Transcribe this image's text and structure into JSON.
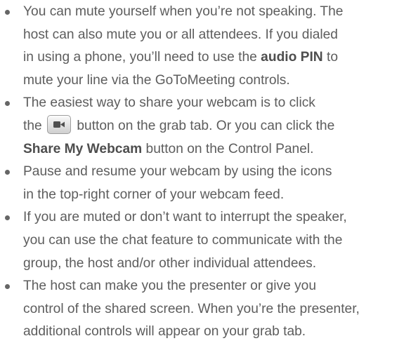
{
  "items": [
    {
      "lines": [
        {
          "text": "You can mute yourself when you’re not speaking. The"
        },
        {
          "text": "host can also mute you or all attendees. If you dialed"
        },
        {
          "before": "in using a phone, you’ll need to use the ",
          "strong": "audio PIN",
          "after": " to"
        },
        {
          "text": "mute your line via the GoToMeeting controls."
        }
      ]
    },
    {
      "lines": [
        {
          "text": "The easiest way to share your webcam is to click"
        },
        {
          "before": "the ",
          "icon": "webcam-icon",
          "after": " button on the grab tab. Or you can click the"
        },
        {
          "strong": "Share My Webcam",
          "after": " button on the Control Panel."
        }
      ]
    },
    {
      "lines": [
        {
          "text": "Pause and resume your webcam by using the icons"
        },
        {
          "text": "in the top-right corner of your webcam feed."
        }
      ]
    },
    {
      "lines": [
        {
          "text": "If you are muted or don’t want to interrupt the speaker,"
        },
        {
          "text": "you can use the chat feature to communicate with the"
        },
        {
          "text": "group, the host and/or other individual attendees."
        }
      ]
    },
    {
      "lines": [
        {
          "text": "The host can make you the presenter or give you"
        },
        {
          "text": "control of the shared screen. When you’re the presenter,"
        },
        {
          "text": "additional controls will appear on your grab tab."
        }
      ]
    }
  ],
  "colors": {
    "text": "#5d5d5d",
    "bullet": "#666666",
    "background": "#ffffff"
  }
}
